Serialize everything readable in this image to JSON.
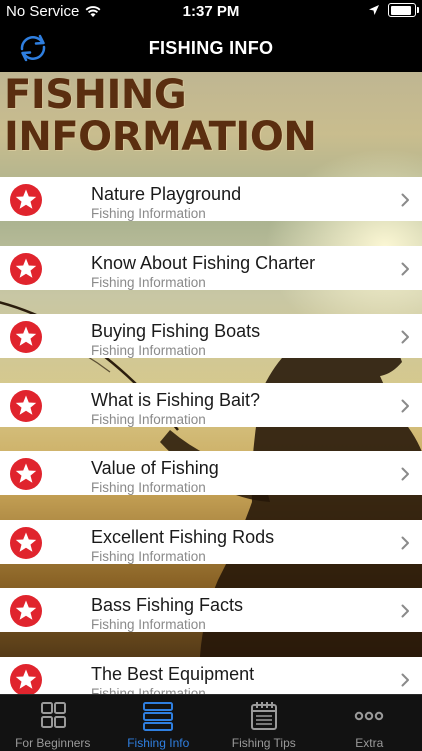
{
  "status": {
    "carrier": "No Service",
    "time": "1:37 PM",
    "battery_level": 0.92
  },
  "nav": {
    "title": "FISHING INFO",
    "refresh_icon": "refresh-icon"
  },
  "banner": {
    "line1": "FISHING",
    "line2": "INFORMATION"
  },
  "items": [
    {
      "title": "Nature Playground",
      "subtitle": "Fishing Information"
    },
    {
      "title": "Know About Fishing Charter",
      "subtitle": "Fishing Information"
    },
    {
      "title": "Buying Fishing Boats",
      "subtitle": "Fishing Information"
    },
    {
      "title": "What is Fishing Bait?",
      "subtitle": "Fishing Information"
    },
    {
      "title": "Value of Fishing",
      "subtitle": "Fishing Information"
    },
    {
      "title": "Excellent Fishing Rods",
      "subtitle": "Fishing Information"
    },
    {
      "title": "Bass Fishing Facts",
      "subtitle": "Fishing Information"
    },
    {
      "title": "The Best Equipment",
      "subtitle": "Fishing Information"
    }
  ],
  "tabs": [
    {
      "label": "For Beginners",
      "icon": "grid-icon"
    },
    {
      "label": "Fishing Info",
      "icon": "list-icon",
      "active": true
    },
    {
      "label": "Fishing Tips",
      "icon": "notepad-icon"
    },
    {
      "label": "Extra",
      "icon": "more-icon"
    }
  ],
  "colors": {
    "accent": "#2f7fe0",
    "badge": "#e0242d",
    "banner_text": "#5a2e10"
  }
}
